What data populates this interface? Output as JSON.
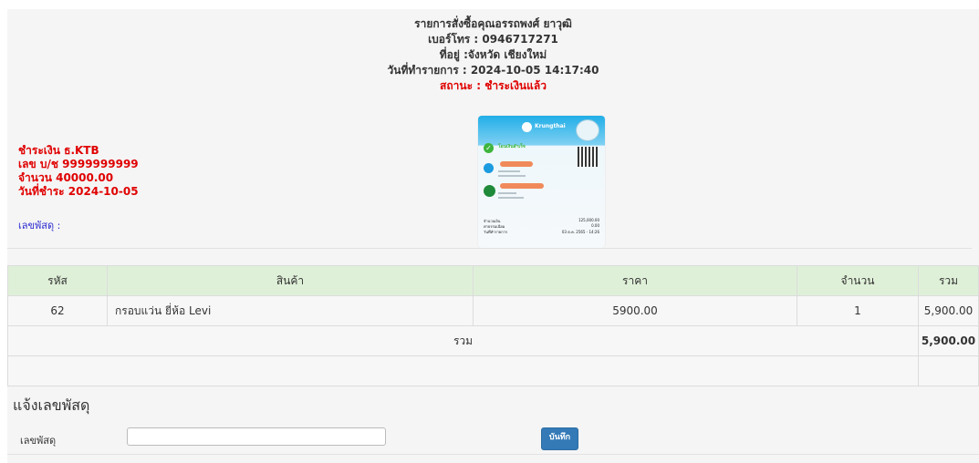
{
  "header": {
    "title": "รายการสั่งซื้อคุณอรรถพงศ์ ยาวุฒิ",
    "phone": "เบอร์โทร : 0946717271",
    "address": "ที่อยู่ :จังหวัด เชียงใหม่",
    "order_date": "วันที่ทำรายการ : 2024-10-05 14:17:40",
    "status_label": "สถานะ",
    "status_value": "ชำระเงินแล้ว"
  },
  "slip": {
    "bank": "Krungthai",
    "result": "โอนเงินสำเร็จ",
    "amount": "125,000.00",
    "fee": "0.00",
    "date": "03 ต.ค. 2565 - 14:26"
  },
  "payment": {
    "bank": "ชำระเงิน ธ.KTB",
    "account": "เลข บ/ช 9999999999",
    "amount": "จำนวน 40000.00",
    "pay_date": "วันที่ชำระ 2024-10-05",
    "tracking_label": "เลขพัสดุ :"
  },
  "table": {
    "headers": [
      "รหัส",
      "สินค้า",
      "ราคา",
      "จำนวน",
      "รวม"
    ],
    "rows": [
      {
        "code": "62",
        "product": "กรอบแว่น ยี่ห้อ Levi",
        "price": "5900.00",
        "qty": "1",
        "total": "5,900.00"
      }
    ],
    "sum_label": "รวม",
    "sum_value": "5,900.00"
  },
  "tracking_form": {
    "section_title": "แจ้งเลขพัสดุ",
    "label": "เลขพัสดุ",
    "value": "",
    "save_label": "บันทึก"
  },
  "colors": {
    "status_red": "#e00000",
    "tracking_blue": "#2a2ad0",
    "table_header_green": "#dff0d8",
    "button_blue": "#337ab7"
  }
}
